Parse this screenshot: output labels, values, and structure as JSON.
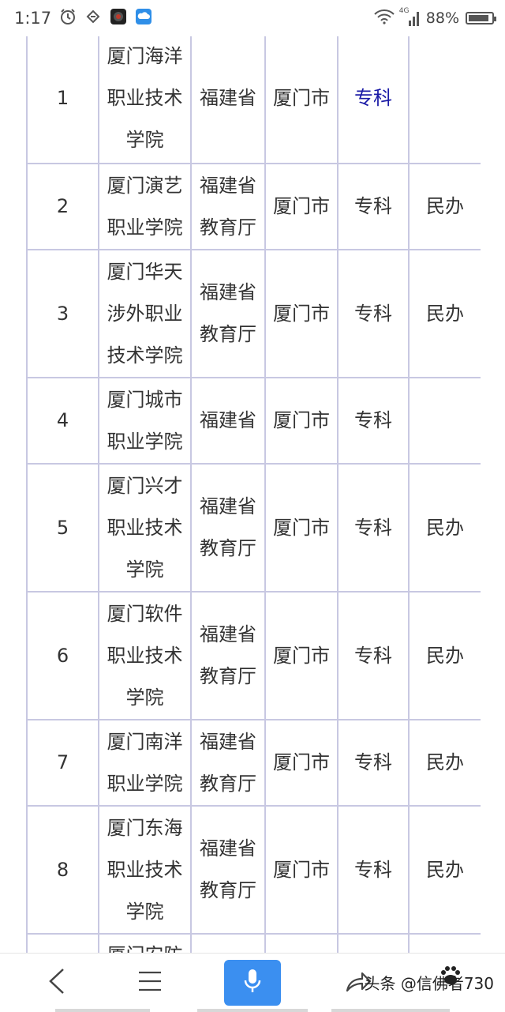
{
  "status_bar": {
    "time": "1:17",
    "network": "4G",
    "battery": "88%",
    "battery_level": 0.88,
    "icons": [
      "alarm-icon",
      "nfc-icon",
      "camera-app-icon",
      "cloud-app-icon",
      "wifi-icon",
      "signal-icon",
      "battery-icon"
    ]
  },
  "table": {
    "rows": [
      {
        "no": "1",
        "name": "厦门海洋职业技术学院",
        "dept": "福建省",
        "city": "厦门市",
        "level": "专科",
        "note": ""
      },
      {
        "no": "2",
        "name": "厦门演艺职业学院",
        "dept": "福建省教育厅",
        "city": "厦门市",
        "level": "专科",
        "note": "民办"
      },
      {
        "no": "3",
        "name": "厦门华天涉外职业技术学院",
        "dept": "福建省教育厅",
        "city": "厦门市",
        "level": "专科",
        "note": "民办"
      },
      {
        "no": "4",
        "name": "厦门城市职业学院",
        "dept": "福建省",
        "city": "厦门市",
        "level": "专科",
        "note": ""
      },
      {
        "no": "5",
        "name": "厦门兴才职业技术学院",
        "dept": "福建省教育厅",
        "city": "厦门市",
        "level": "专科",
        "note": "民办"
      },
      {
        "no": "6",
        "name": "厦门软件职业技术学院",
        "dept": "福建省教育厅",
        "city": "厦门市",
        "level": "专科",
        "note": "民办"
      },
      {
        "no": "7",
        "name": "厦门南洋职业学院",
        "dept": "福建省教育厅",
        "city": "厦门市",
        "level": "专科",
        "note": "民办"
      },
      {
        "no": "8",
        "name": "厦门东海职业技术学院",
        "dept": "福建省教育厅",
        "city": "厦门市",
        "level": "专科",
        "note": "民办"
      },
      {
        "no": "",
        "name": "厦门安防",
        "dept": "",
        "city": "",
        "level": "",
        "note": ""
      }
    ]
  },
  "bottom_bar": {
    "watermark": "头条 @信佛者730",
    "icons": [
      "back-icon",
      "menu-icon",
      "microphone-icon",
      "share-icon",
      "paw-icon"
    ]
  },
  "colors": {
    "table_border": "#c8c8e2",
    "link": "#1a1aa6",
    "mic_button": "#3b8ff0"
  }
}
